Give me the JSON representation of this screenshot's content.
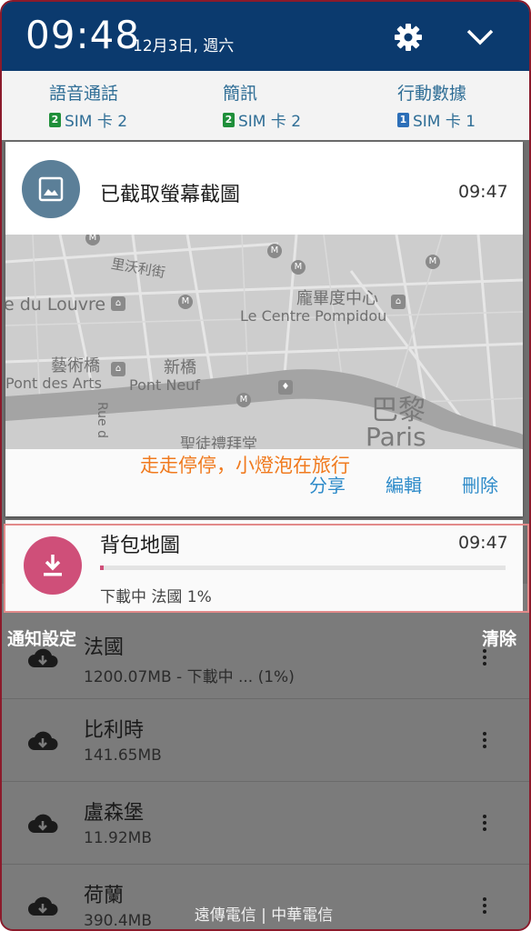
{
  "status": {
    "time": "09:48",
    "date": "12月3日, 週六"
  },
  "sim": [
    {
      "label": "語音通話",
      "card": "SIM 卡 2",
      "slot": "2",
      "color": "#1f8f3a"
    },
    {
      "label": "簡訊",
      "card": "SIM 卡 2",
      "slot": "2",
      "color": "#1f8f3a"
    },
    {
      "label": "行動數據",
      "card": "SIM 卡 1",
      "slot": "1",
      "color": "#2d6fb8"
    }
  ],
  "screenshot_notification": {
    "title": "已截取螢幕截圖",
    "time": "09:47",
    "caption": "走走停停，小燈泡在旅行",
    "actions": {
      "share": "分享",
      "edit": "編輯",
      "delete": "刪除"
    },
    "map_labels": {
      "louvre": "e du Louvre",
      "street": "里沃利街",
      "pompidou_zh": "龐畢度中心",
      "pompidou_fr": "Le Centre Pompidou",
      "arts_zh": "藝術橋",
      "arts_fr": "Pont des Arts",
      "neuf_zh": "新橋",
      "neuf_fr": "Pont Neuf",
      "paris_zh": "巴黎",
      "paris_fr": "Paris",
      "rue": "Rue d",
      "chapel": "聖徒禮拜堂"
    }
  },
  "download_notification": {
    "title": "背包地圖",
    "time": "09:47",
    "progress": 0.01,
    "status": "下載中 法國 1%"
  },
  "footer": {
    "notification_settings": "通知設定",
    "clear": "清除",
    "carrier": "遠傳電信 | 中華電信"
  },
  "downloads": [
    {
      "name": "法國",
      "size": "1200.07MB - 下載中 ... (1%)"
    },
    {
      "name": "比利時",
      "size": "141.65MB"
    },
    {
      "name": "盧森堡",
      "size": "11.92MB"
    },
    {
      "name": "荷蘭",
      "size": "390.4MB"
    }
  ]
}
